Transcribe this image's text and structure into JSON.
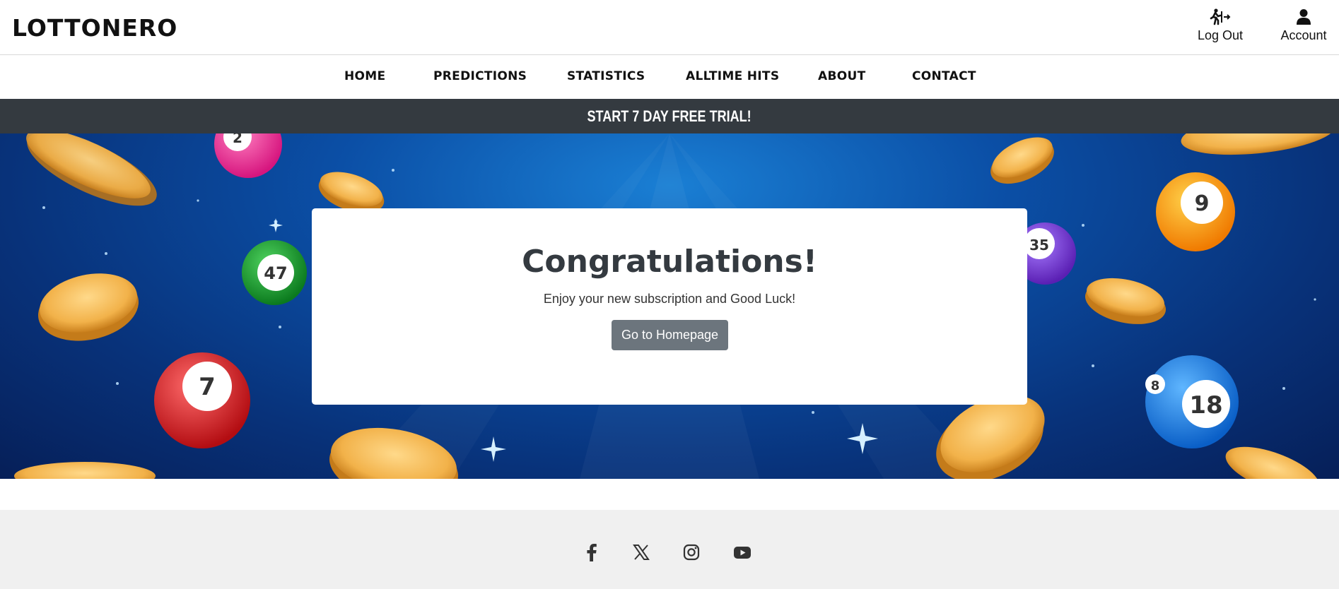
{
  "header": {
    "logo": "LOTTONERO",
    "logout_label": "Log Out",
    "account_label": "Account"
  },
  "nav": {
    "items": [
      {
        "label": "HOME"
      },
      {
        "label": "PREDICTIONS"
      },
      {
        "label": "STATISTICS"
      },
      {
        "label": "ALLTIME HITS"
      },
      {
        "label": "ABOUT"
      },
      {
        "label": "CONTACT"
      }
    ]
  },
  "banner": {
    "trial_label": "START 7 DAY FREE TRIAL!",
    "background": "#343a40"
  },
  "hero": {
    "title": "Congratulations!",
    "subtitle": "Enjoy your new subscription and Good Luck!",
    "button_label": "Go to Homepage",
    "ball_numbers": [
      "2",
      "47",
      "7",
      "35",
      "9",
      "18",
      "8"
    ]
  },
  "footer": {
    "social_icons": [
      "facebook-icon",
      "x-twitter-icon",
      "instagram-icon",
      "youtube-icon"
    ]
  },
  "colors": {
    "hero_blue": "#0b4fa6",
    "button_gray": "#6c757d",
    "footer_bg": "#f0f0f0"
  }
}
